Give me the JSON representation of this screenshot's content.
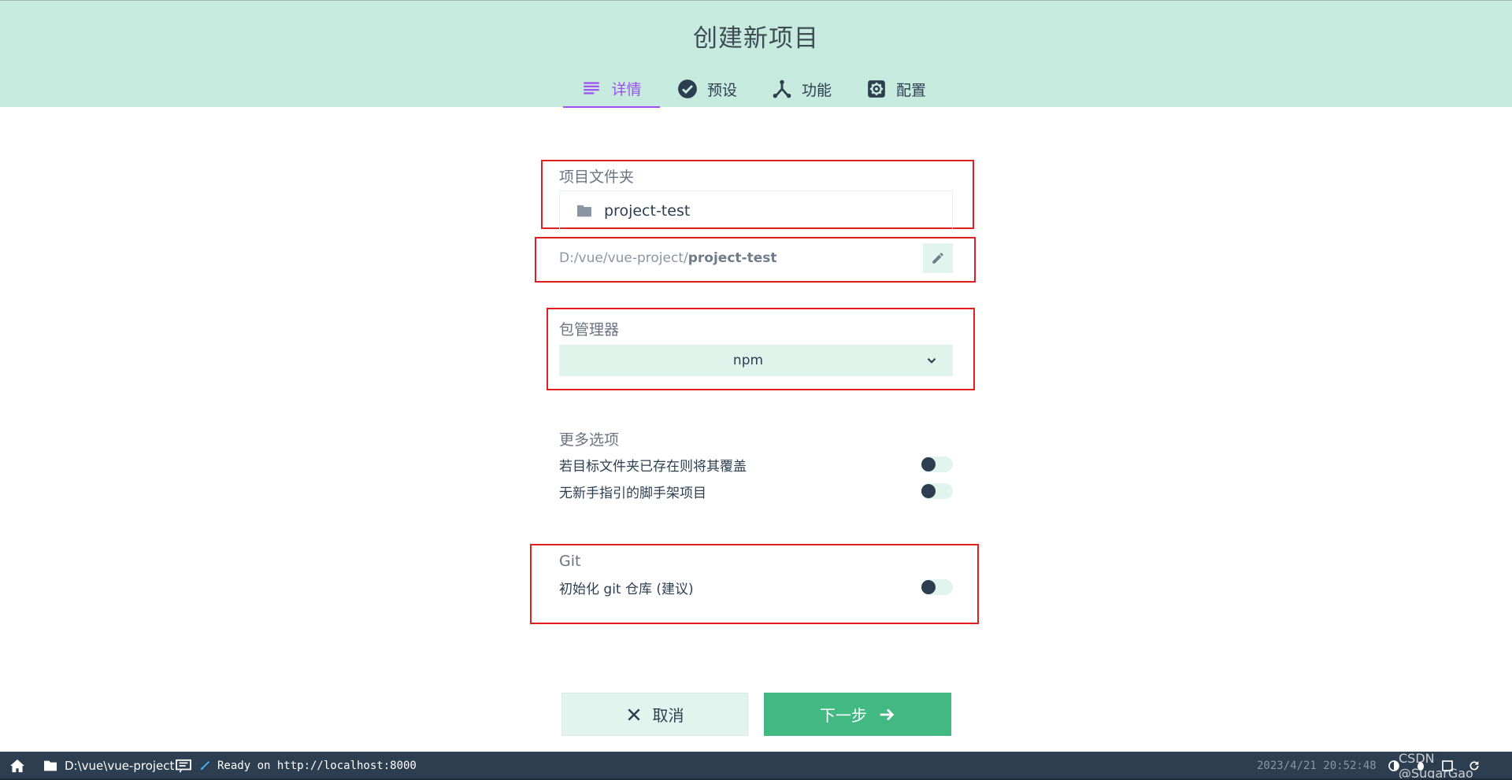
{
  "header": {
    "title": "创建新项目",
    "tabs": [
      {
        "label": "详情",
        "icon": "list-icon",
        "active": true
      },
      {
        "label": "预设",
        "icon": "check-circle-icon",
        "active": false
      },
      {
        "label": "功能",
        "icon": "fork-icon",
        "active": false
      },
      {
        "label": "配置",
        "icon": "gear-icon",
        "active": false
      }
    ]
  },
  "form": {
    "folder_label": "项目文件夹",
    "folder_value": "project-test",
    "path_prefix": "D:/vue/vue-project/",
    "path_bold": "project-test",
    "pm_label": "包管理器",
    "pm_value": "npm",
    "more_label": "更多选项",
    "options": [
      {
        "label": "若目标文件夹已存在则将其覆盖",
        "on": false
      },
      {
        "label": "无新手指引的脚手架项目",
        "on": false
      }
    ],
    "git_label": "Git",
    "git_option": {
      "label": "初始化 git 仓库 (建议)",
      "on": false
    }
  },
  "actions": {
    "cancel_label": "取消",
    "next_label": "下一步"
  },
  "statusbar": {
    "path": "D:\\vue\\vue-project",
    "log": "Ready on http://localhost:8000",
    "time": "2023/4/21 20:52:48",
    "watermark": "CSDN @SugarGao"
  },
  "colors": {
    "header_bg": "#c6ebde",
    "accent_purple": "#a44cf2",
    "primary_green": "#42b983",
    "statusbar_bg": "#2c3e50",
    "annotation_red": "#e02020"
  }
}
